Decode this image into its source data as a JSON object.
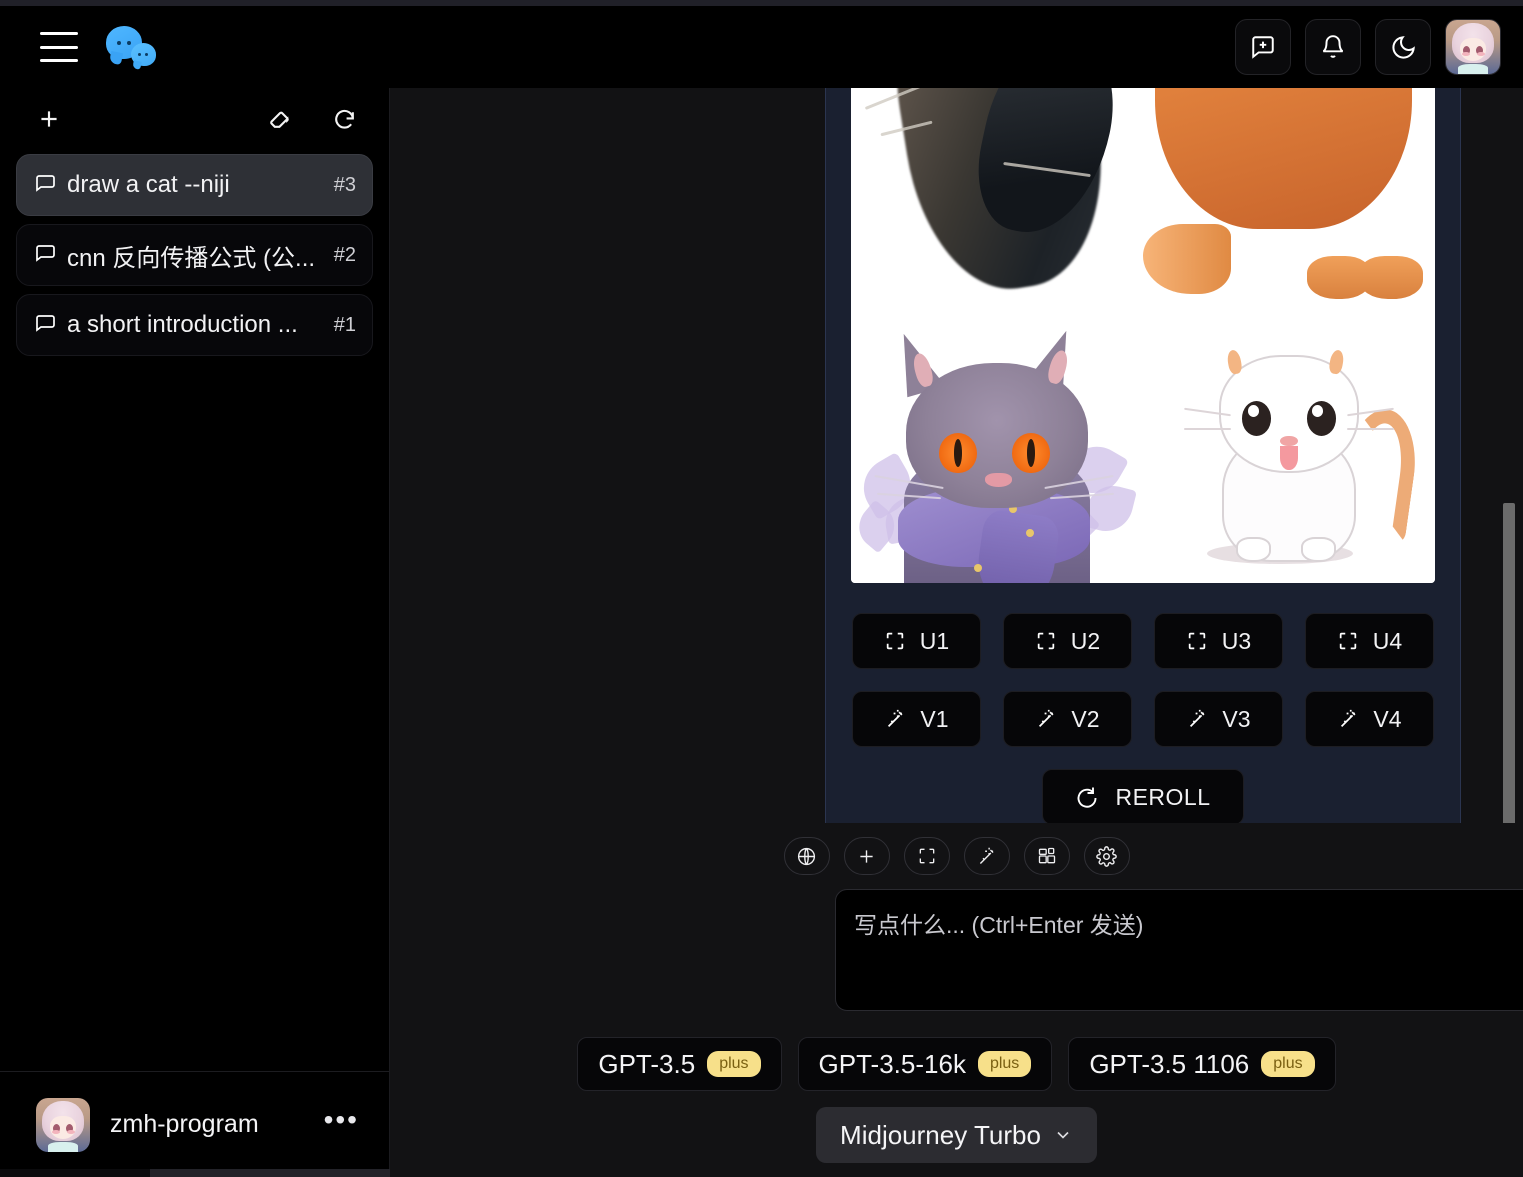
{
  "header": {
    "menu_icon": "hamburger-icon",
    "logo_icon": "chat-bubbles-logo",
    "actions": [
      {
        "name": "new-chat",
        "icon": "message-plus-icon"
      },
      {
        "name": "notifications",
        "icon": "bell-icon"
      },
      {
        "name": "dark-mode-toggle",
        "icon": "moon-icon"
      },
      {
        "name": "profile",
        "icon": "avatar-image"
      }
    ]
  },
  "sidebar": {
    "toolbar": {
      "new_chat_icon": "plus-icon",
      "clear_icon": "eraser-icon",
      "refresh_icon": "refresh-icon"
    },
    "chats": [
      {
        "title": "draw a cat --niji",
        "count": "#3",
        "active": true
      },
      {
        "title": "cnn 反向传播公式 (公...",
        "count": "#2",
        "active": false
      },
      {
        "title": "a short introduction ...",
        "count": "#1",
        "active": false
      }
    ],
    "footer": {
      "username": "zmh-program",
      "more_label": "•••"
    }
  },
  "message": {
    "image_grid_alt": "midjourney 2x2 cat grid",
    "upscale_buttons": [
      {
        "label": "U1",
        "icon": "crop-corners-icon"
      },
      {
        "label": "U2",
        "icon": "crop-corners-icon"
      },
      {
        "label": "U3",
        "icon": "crop-corners-icon"
      },
      {
        "label": "U4",
        "icon": "crop-corners-icon"
      }
    ],
    "variation_buttons": [
      {
        "label": "V1",
        "icon": "magic-wand-icon"
      },
      {
        "label": "V2",
        "icon": "magic-wand-icon"
      },
      {
        "label": "V3",
        "icon": "magic-wand-icon"
      },
      {
        "label": "V4",
        "icon": "magic-wand-icon"
      }
    ],
    "reroll": {
      "label": "REROLL",
      "icon": "refresh-icon"
    },
    "menu_icon": "more-vertical-icon"
  },
  "composer": {
    "tools": [
      {
        "name": "web-search",
        "icon": "globe-icon"
      },
      {
        "name": "add-attachment",
        "icon": "plus-icon"
      },
      {
        "name": "fullscreen",
        "icon": "crop-corners-icon"
      },
      {
        "name": "magic",
        "icon": "magic-wand-icon"
      },
      {
        "name": "plugins",
        "icon": "grid-blocks-icon"
      },
      {
        "name": "settings",
        "icon": "gear-icon"
      }
    ],
    "input": {
      "value": "",
      "placeholder": "写点什么... (Ctrl+Enter 发送)"
    },
    "send": {
      "icon": "send-arrow-icon"
    },
    "models": [
      {
        "label": "GPT-3.5",
        "badge": "plus"
      },
      {
        "label": "GPT-3.5-16k",
        "badge": "plus"
      },
      {
        "label": "GPT-3.5 1106",
        "badge": "plus"
      }
    ],
    "selected_model": {
      "label": "Midjourney Turbo",
      "chevron": "chevron-down-icon"
    }
  },
  "colors": {
    "accent_blue": "#3aa3f5",
    "badge_yellow": "#f7e08a",
    "badge_text": "#7a6012",
    "sidebar_bg": "#000000",
    "main_bg": "#121214",
    "bubble_bg": "#1a2030",
    "bubble_border": "#2b3550",
    "active_item_bg": "#2e3036",
    "scrollbar": "#6b6b6b"
  }
}
